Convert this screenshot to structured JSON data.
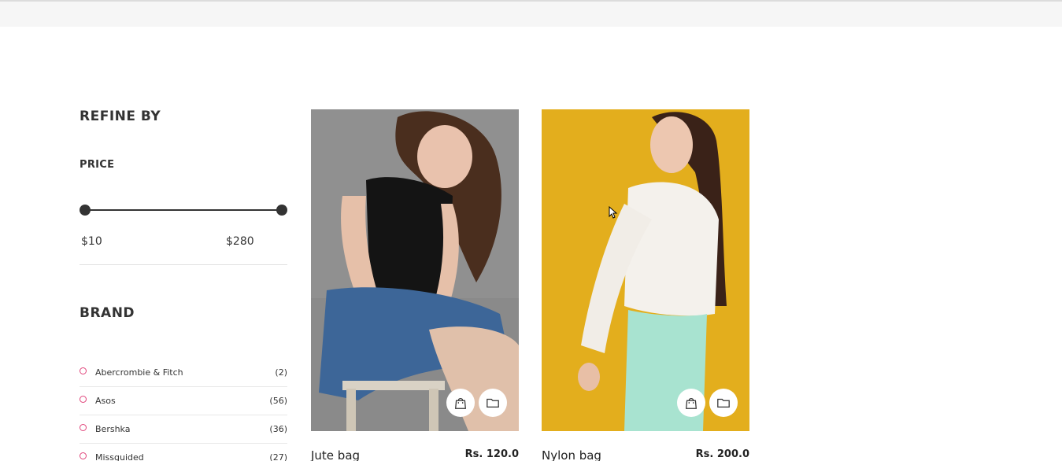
{
  "sidebar": {
    "title": "REFINE BY",
    "price": {
      "heading": "PRICE",
      "min_label": "$10",
      "max_label": "$280"
    },
    "brand": {
      "heading": "BRAND",
      "items": [
        {
          "name": "Abercrombie & Fitch",
          "count": "(2)"
        },
        {
          "name": "Asos",
          "count": "(56)"
        },
        {
          "name": "Bershka",
          "count": "(36)"
        },
        {
          "name": "Missguided",
          "count": "(27)"
        }
      ]
    }
  },
  "products": [
    {
      "name": "Jute bag",
      "price": "Rs. 120.0",
      "image": "woman-in-black-top-denim-shorts-photo"
    },
    {
      "name": "Nylon bag",
      "price": "Rs. 200.0",
      "image": "woman-in-white-lace-blouse-on-yellow-photo"
    }
  ],
  "icons": {
    "cart": "shopping-bag-icon",
    "compare": "folder-icon"
  },
  "colors": {
    "accent_dot": "#e0457b",
    "text": "#333333",
    "yellow_bg": "#e3ae1d"
  }
}
